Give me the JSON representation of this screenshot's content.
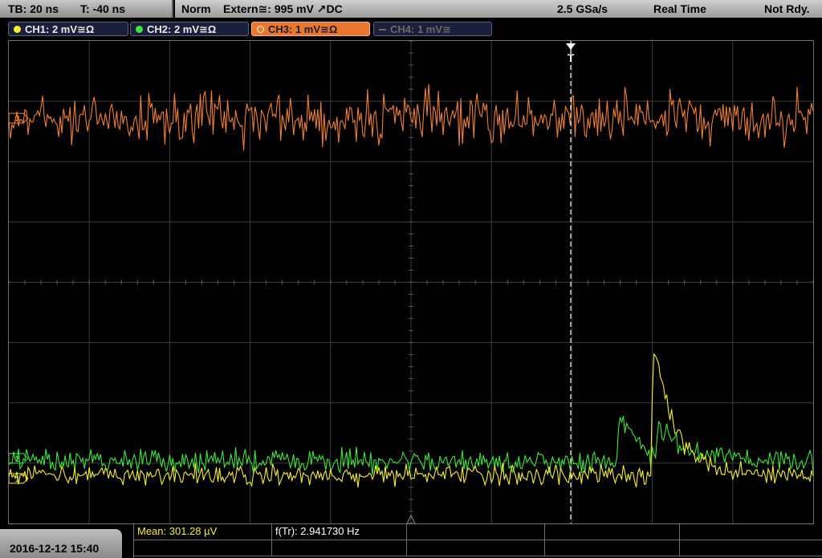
{
  "header": {
    "timebase": "TB: 20 ns",
    "trigger_offset": "T: -40 ns",
    "trigger_mode": "Norm",
    "trigger_source": "Extern≅: 995 mV ↗DC",
    "sample_rate": "2.5 GSa/s",
    "acq_mode": "Real Time",
    "status": "Not Rdy."
  },
  "channels": [
    {
      "label": "CH1: 2 mV≅Ω",
      "color": "#f7f030",
      "active": true
    },
    {
      "label": "CH2: 2 mV≅Ω",
      "color": "#3ce83c",
      "active": true
    },
    {
      "label": "CH3: 1 mV≅Ω",
      "color": "#f08030",
      "active": true,
      "selected": true
    },
    {
      "label": "CH4: 1 mV≅",
      "color": "#6a6a6a",
      "active": false
    }
  ],
  "markers": {
    "trigger": "T",
    "ch3": "3",
    "ch2": "2",
    "ch1": "1"
  },
  "colors": {
    "ch1": "#f7f030",
    "ch2": "#3ce83c",
    "ch3": "#f08030",
    "grid": "#3c3c3c"
  },
  "footer": {
    "datetime": "2016-12-12 15:40",
    "measurements": [
      {
        "label": "Mean: 301.28 µV",
        "color": "#f7f030"
      },
      {
        "label": "f(Tr): 2.941730 Hz",
        "color": "#ffffff"
      }
    ]
  },
  "chart_data": {
    "type": "line",
    "grid": true,
    "series": [
      {
        "name": "CH3",
        "note": "noise",
        "level": 0.16
      },
      {
        "name": "CH2",
        "note": "noise with two peaks",
        "level": 0.87
      },
      {
        "name": "CH1",
        "note": "noise with peak",
        "level": 0.9
      }
    ]
  }
}
